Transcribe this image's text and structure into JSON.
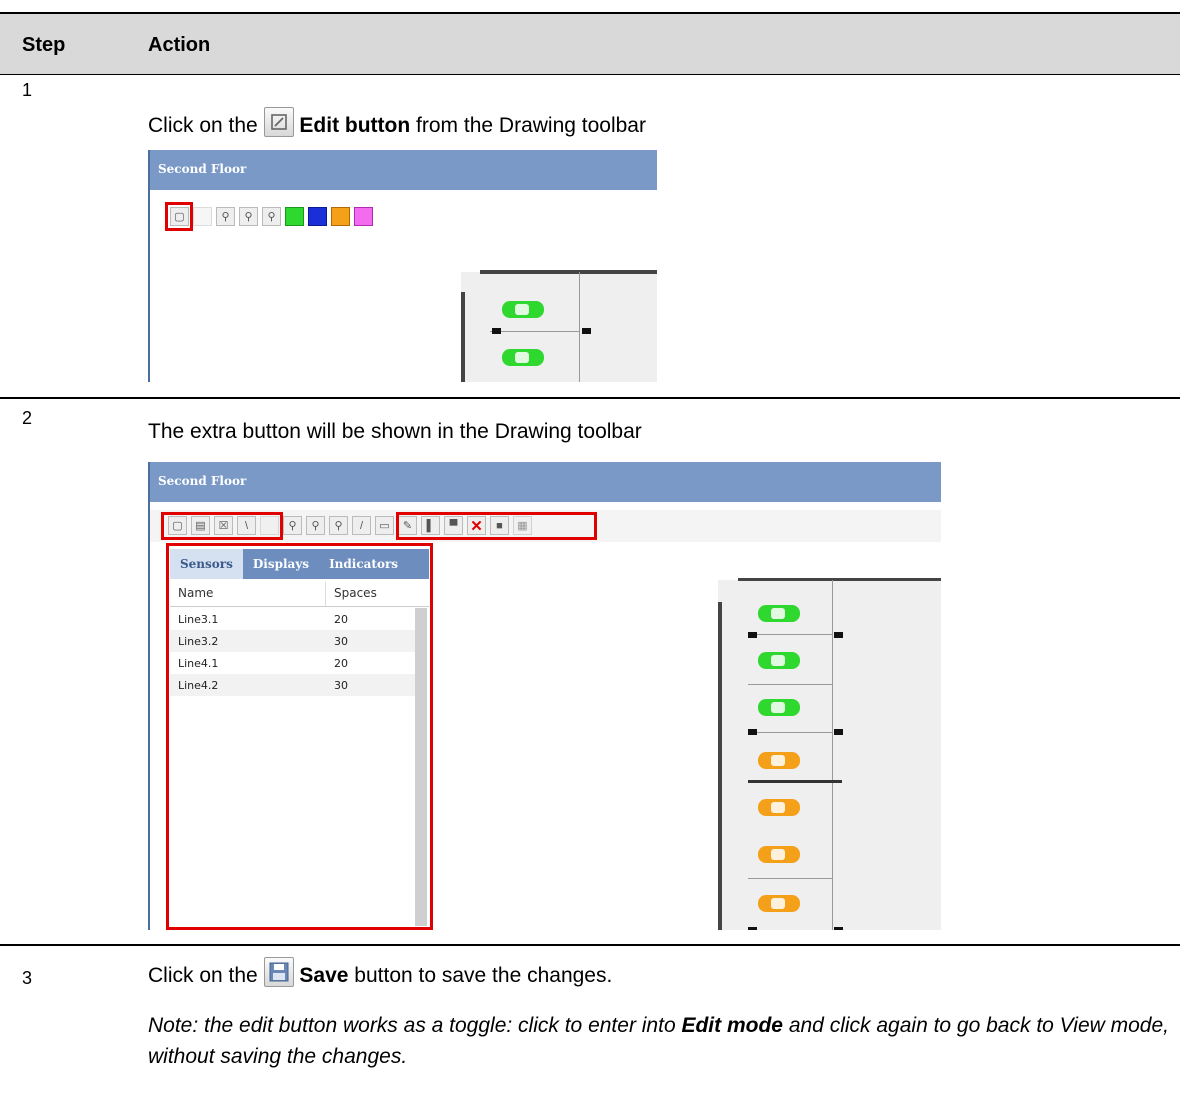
{
  "table": {
    "header_step": "Step",
    "header_action": "Action"
  },
  "steps": [
    {
      "number": "1",
      "pre": "Click on the",
      "bold": "Edit button",
      "post": "from the Drawing toolbar"
    },
    {
      "number": "2",
      "text": "The extra button will be shown in the Drawing toolbar"
    },
    {
      "number": "3",
      "pre": "Click on the",
      "bold": "Save",
      "post": "button to save the changes.",
      "note_pre": "Note: the edit button works as a toggle: click to enter into",
      "note_bold": "Edit mode",
      "note_post": "and click again to go back to View mode, without saving the changes."
    }
  ],
  "screenshot1": {
    "title": "Second Floor",
    "icons": [
      "edit-icon",
      "disabled-icon",
      "zoom-in-icon",
      "zoom-icon",
      "zoom-out-icon",
      "green-flag-icon",
      "blue-flag-icon",
      "orange-flag-icon",
      "pink-flag-icon"
    ]
  },
  "screenshot2": {
    "title": "Second Floor",
    "tabs": [
      "Sensors",
      "Displays",
      "Indicators"
    ],
    "columns": [
      "Name",
      "Spaces"
    ],
    "rows": [
      {
        "name": "Line3.1",
        "spaces": "20"
      },
      {
        "name": "Line3.2",
        "spaces": "30"
      },
      {
        "name": "Line4.1",
        "spaces": "20"
      },
      {
        "name": "Line4.2",
        "spaces": "30"
      }
    ]
  },
  "colors": {
    "title_bar": "#7a99c7",
    "highlight": "#e00000",
    "car_free": "#2ed82e",
    "car_occupied": "#f5a019"
  }
}
